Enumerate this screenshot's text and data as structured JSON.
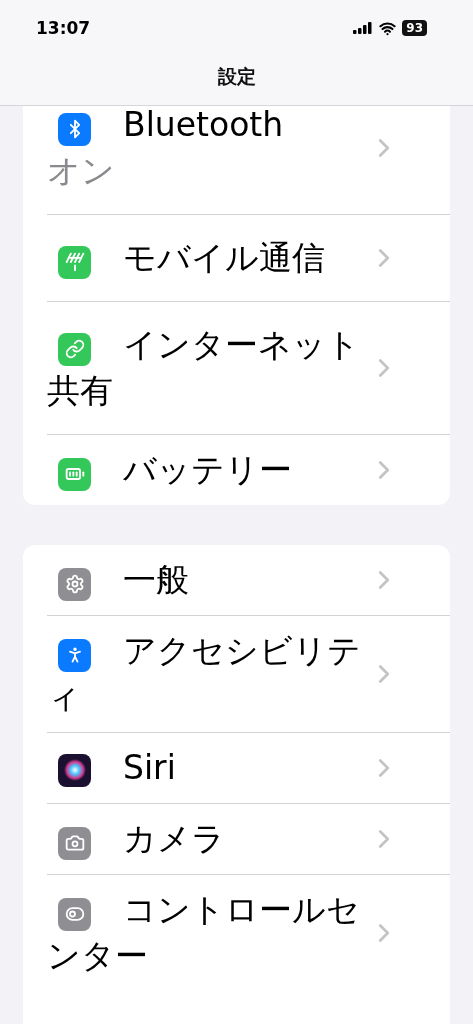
{
  "status_bar": {
    "time": "13:07",
    "battery": "93"
  },
  "nav": {
    "title": "設定"
  },
  "groups": [
    {
      "items": [
        {
          "kind": "bluetooth",
          "color": "#0a7aff",
          "title": "Bluetooth",
          "value": "オン"
        },
        {
          "kind": "antenna",
          "color": "#34c759",
          "title": "モバイル通信"
        },
        {
          "kind": "link",
          "color": "#34c759",
          "title": "インターネット共有"
        },
        {
          "kind": "battery",
          "color": "#34c759",
          "title": "バッテリー"
        }
      ]
    },
    {
      "items": [
        {
          "kind": "gear",
          "color": "#8e8e93",
          "title": "一般"
        },
        {
          "kind": "accessibility",
          "color": "#0a7aff",
          "title": "アクセシビリティ"
        },
        {
          "kind": "siri",
          "color": "#1c1030",
          "title": "Siri"
        },
        {
          "kind": "camera",
          "color": "#8e8e93",
          "title": "カメラ"
        },
        {
          "kind": "toggles",
          "color": "#8e8e93",
          "title": "コントロールセンター"
        }
      ]
    }
  ]
}
